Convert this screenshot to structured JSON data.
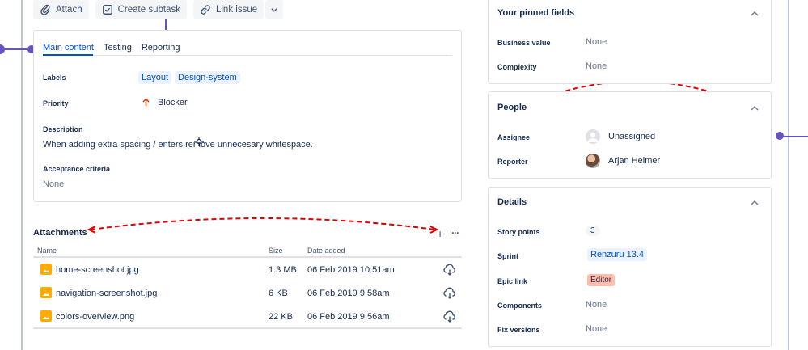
{
  "toolbar": {
    "attach_label": "Attach",
    "subtask_label": "Create subtask",
    "link_label": "Link issue"
  },
  "tabs": [
    {
      "label": "Main content",
      "active": true
    },
    {
      "label": "Testing",
      "active": false
    },
    {
      "label": "Reporting",
      "active": false
    }
  ],
  "fields": {
    "labels_label": "Labels",
    "labels": [
      "Layout",
      "Design-system"
    ],
    "priority_label": "Priority",
    "priority_value": "Blocker",
    "description_label": "Description",
    "description_value": "When adding extra spacing / enters remove unnecesary whitespace.",
    "acceptance_label": "Acceptance criteria",
    "acceptance_value": "None"
  },
  "attachments": {
    "title": "Attachments",
    "columns": [
      "Name",
      "Size",
      "Date added"
    ],
    "rows": [
      {
        "name": "home-screenshot.jpg",
        "size": "1.3 MB",
        "date": "06 Feb 2019 10:51am"
      },
      {
        "name": "navigation-screenshot.jpg",
        "size": "6 KB",
        "date": "06 Feb 2019 9:58am"
      },
      {
        "name": "colors-overview.png",
        "size": "22 KB",
        "date": "06 Feb 2019 9:56am"
      }
    ]
  },
  "pinned": {
    "title": "Your pinned fields",
    "business_value_label": "Business value",
    "business_value": "None",
    "complexity_label": "Complexity",
    "complexity": "None"
  },
  "people": {
    "title": "People",
    "assignee_label": "Assignee",
    "assignee": "Unassigned",
    "reporter_label": "Reporter",
    "reporter": "Arjan Helmer"
  },
  "details": {
    "title": "Details",
    "story_points_label": "Story points",
    "story_points": "3",
    "sprint_label": "Sprint",
    "sprint": "Renzuru 13.4",
    "epic_label": "Epic link",
    "epic": "Editor",
    "components_label": "Components",
    "components": "None",
    "fix_versions_label": "Fix versions",
    "fix_versions": "None"
  },
  "colors": {
    "accent": "#0052CC",
    "annotation_purple": "#6554C0",
    "annotation_red": "#E00000",
    "priority_red": "#DE350B"
  }
}
